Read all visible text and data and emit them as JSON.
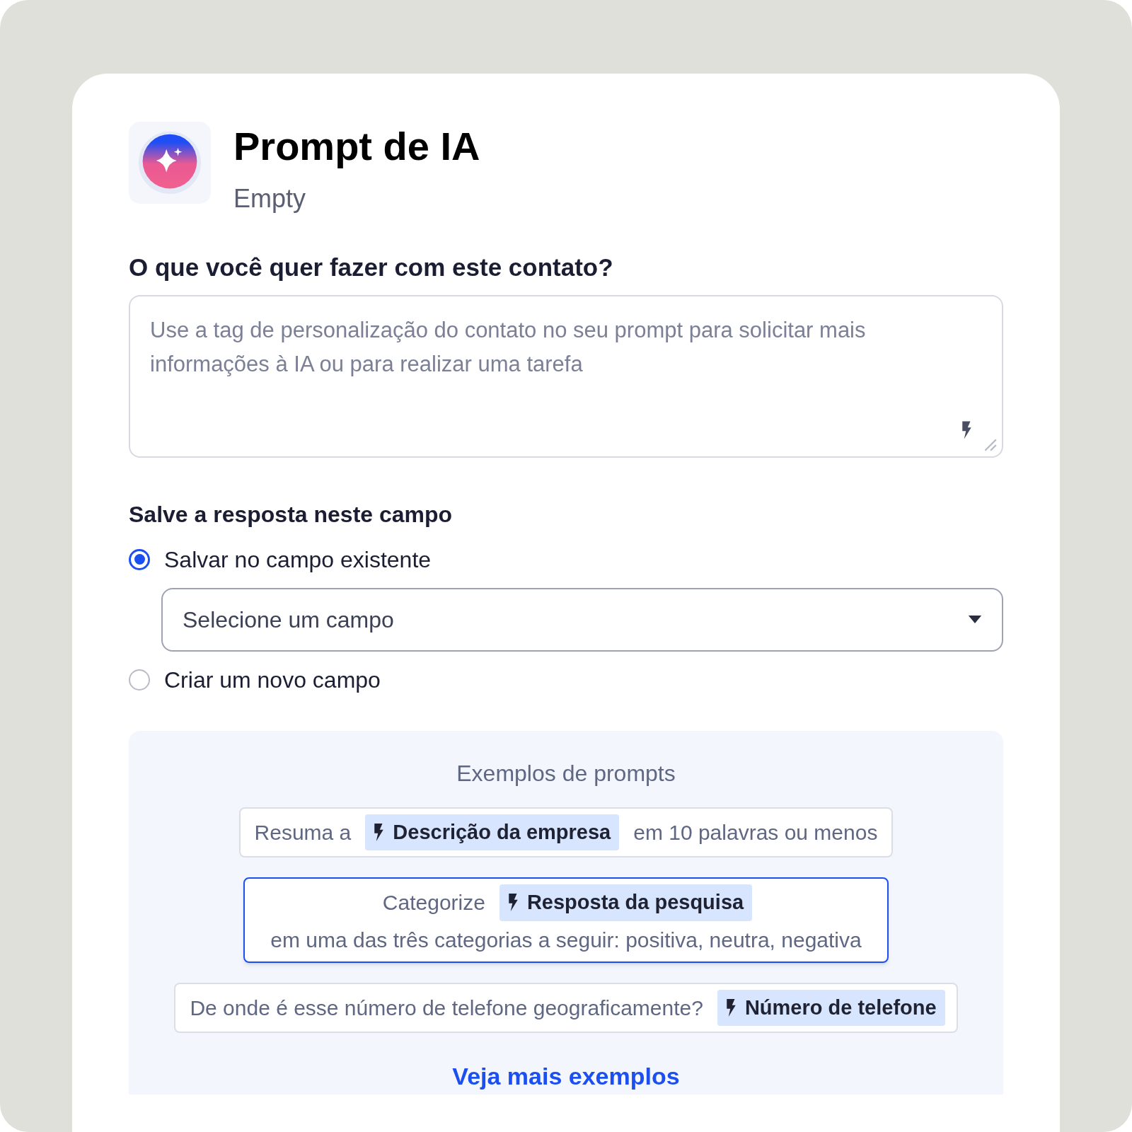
{
  "header": {
    "title": "Prompt de IA",
    "subtitle": "Empty"
  },
  "prompt": {
    "label": "O que você quer fazer com este contato?",
    "placeholder": "Use a tag de personalização do contato no seu prompt para solicitar mais informações à IA ou para realizar uma tarefa"
  },
  "save": {
    "label": "Salve a resposta neste campo",
    "options": [
      {
        "label": "Salvar no campo existente",
        "selected": true,
        "select": {
          "placeholder": "Selecione um campo"
        }
      },
      {
        "label": "Criar um novo campo",
        "selected": false
      }
    ]
  },
  "examples": {
    "title": "Exemplos de prompts",
    "items": [
      {
        "selected": false,
        "parts": [
          {
            "kind": "text",
            "text": "Resuma a"
          },
          {
            "kind": "tag",
            "text": "Descrição da empresa"
          },
          {
            "kind": "text",
            "text": "em 10 palavras ou menos"
          }
        ]
      },
      {
        "selected": true,
        "parts": [
          {
            "kind": "text",
            "text": "Categorize"
          },
          {
            "kind": "tag",
            "text": "Resposta da pesquisa"
          },
          {
            "kind": "break"
          },
          {
            "kind": "text",
            "text": "em uma das três categorias a seguir: positiva, neutra, negativa"
          }
        ]
      },
      {
        "selected": false,
        "parts": [
          {
            "kind": "text",
            "text": "De onde é esse número de telefone geograficamente?"
          },
          {
            "kind": "tag",
            "text": "Número de telefone"
          }
        ]
      }
    ],
    "link": "Veja mais exemplos"
  }
}
